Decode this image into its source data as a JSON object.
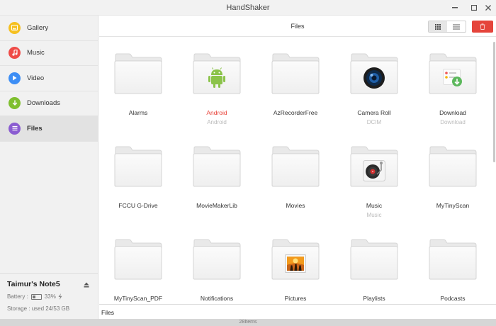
{
  "window": {
    "title": "HandShaker"
  },
  "sidebar": {
    "items": [
      {
        "label": "Gallery",
        "icon": "gallery-icon",
        "color": "#f5c020"
      },
      {
        "label": "Music",
        "icon": "music-icon",
        "color": "#ef4b47"
      },
      {
        "label": "Video",
        "icon": "video-icon",
        "color": "#3d8ef5"
      },
      {
        "label": "Downloads",
        "icon": "download-icon",
        "color": "#7fbf2f"
      },
      {
        "label": "Files",
        "icon": "files-icon",
        "color": "#8a5cd1"
      }
    ],
    "active": "Files",
    "device": {
      "name": "Taimur's Note5",
      "battery_label": "Battery :",
      "battery_percent": "33%",
      "battery_level": 0.33,
      "storage": "Storage : used 24/53 GB"
    }
  },
  "toolbar": {
    "title": "Files"
  },
  "folders": [
    {
      "name": "Alarms",
      "sub": "",
      "badge": "",
      "highlight": false
    },
    {
      "name": "Android",
      "sub": "Android",
      "badge": "android-icon",
      "highlight": true
    },
    {
      "name": "AzRecorderFree",
      "sub": "",
      "badge": "",
      "highlight": false
    },
    {
      "name": "Camera Roll",
      "sub": "DCIM",
      "badge": "camera-lens-icon",
      "highlight": false
    },
    {
      "name": "Download",
      "sub": "Download",
      "badge": "download-badge-icon",
      "highlight": false
    },
    {
      "name": "FCCU G-Drive",
      "sub": "",
      "badge": "",
      "highlight": false
    },
    {
      "name": "MovieMakerLib",
      "sub": "",
      "badge": "",
      "highlight": false
    },
    {
      "name": "Movies",
      "sub": "",
      "badge": "",
      "highlight": false
    },
    {
      "name": "Music",
      "sub": "Music",
      "badge": "record-player-icon",
      "highlight": false
    },
    {
      "name": "MyTinyScan",
      "sub": "",
      "badge": "",
      "highlight": false
    },
    {
      "name": "MyTinyScan_PDF",
      "sub": "",
      "badge": "",
      "highlight": false
    },
    {
      "name": "Notifications",
      "sub": "",
      "badge": "",
      "highlight": false
    },
    {
      "name": "Pictures",
      "sub": "",
      "badge": "picture-icon",
      "highlight": false
    },
    {
      "name": "Playlists",
      "sub": "",
      "badge": "",
      "highlight": false
    },
    {
      "name": "Podcasts",
      "sub": "",
      "badge": "",
      "highlight": false
    }
  ],
  "pathbar": {
    "path": "Files"
  },
  "status": {
    "count": "28Items"
  },
  "colors": {
    "accent_red": "#e5443b",
    "highlight_text": "#e8443b"
  }
}
